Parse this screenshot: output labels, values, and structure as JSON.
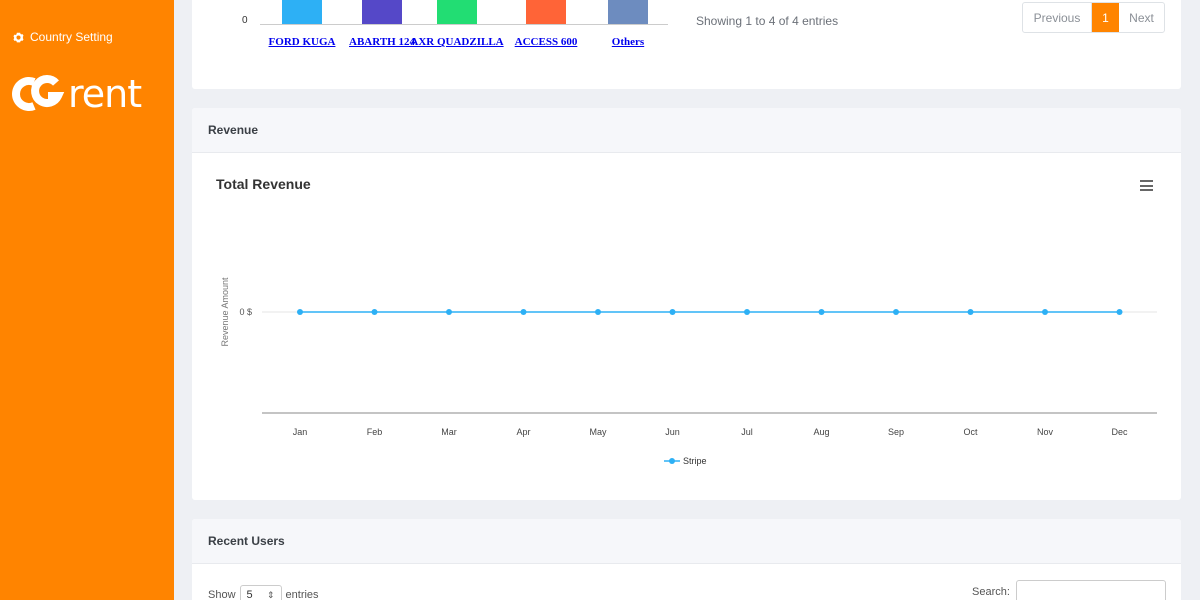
{
  "sidebar": {
    "country_setting": "Country Setting",
    "logo_text": "rent"
  },
  "top_chart": {
    "zero_label": "0",
    "bars": [
      {
        "label": "FORD KUGA",
        "color": "#2db0f5"
      },
      {
        "label": "ABARTH 124",
        "color": "#5548c8"
      },
      {
        "label": "AXR QUADZILLA",
        "color": "#22dd73"
      },
      {
        "label": "ACCESS 600",
        "color": "#ff6437"
      },
      {
        "label": "Others",
        "color": "#6d8cbf"
      }
    ]
  },
  "table_info": {
    "showing": "Showing 1 to 4 of 4 entries",
    "previous": "Previous",
    "current_page": "1",
    "next": "Next"
  },
  "revenue": {
    "header": "Revenue",
    "title": "Total Revenue"
  },
  "chart_data": {
    "type": "line",
    "title": "Total Revenue",
    "categories": [
      "Jan",
      "Feb",
      "Mar",
      "Apr",
      "May",
      "Jun",
      "Jul",
      "Aug",
      "Sep",
      "Oct",
      "Nov",
      "Dec"
    ],
    "series": [
      {
        "name": "Stripe",
        "values": [
          0,
          0,
          0,
          0,
          0,
          0,
          0,
          0,
          0,
          0,
          0,
          0
        ],
        "color": "#2db0f5"
      }
    ],
    "ylabel": "Revenue Amount",
    "ytick": "0 $",
    "legend": "bottom"
  },
  "recent_users": {
    "header": "Recent Users",
    "show_label": "Show",
    "entries_value": "5",
    "entries_label": "entries",
    "search_label": "Search:",
    "search_value": ""
  }
}
